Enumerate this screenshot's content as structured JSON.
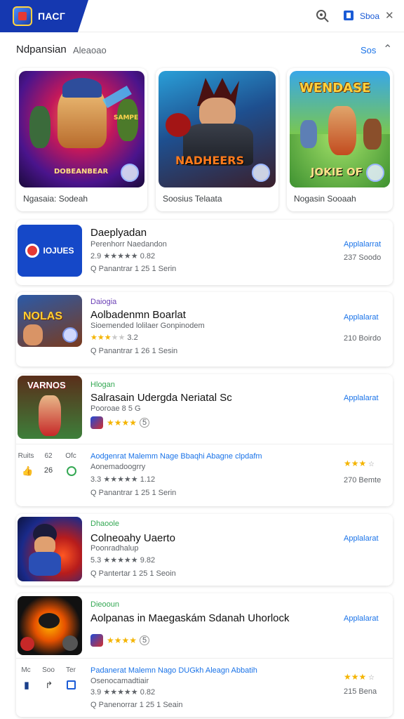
{
  "header": {
    "brand": "ПАСГ",
    "account_label": "Sboa",
    "icons": {
      "search": "search-icon",
      "account": "account-icon",
      "close": "close-icon"
    }
  },
  "section": {
    "title": "Ndpansian",
    "subtitle": "Aleaoao",
    "more": "Sos"
  },
  "featured": [
    {
      "label": "Ngasaia: Sodeah",
      "art_title": "DOBEANBEAR",
      "top_text": "SAMPE"
    },
    {
      "label": "Soosius Telaata",
      "art_title": "NADHEERS",
      "top_text": ""
    },
    {
      "label": "Nogasin Sooaah",
      "art_title": "WENDASE",
      "bottom_text": "JOKIE OF"
    }
  ],
  "list": [
    {
      "tag": "",
      "name": "Daeplyadan",
      "sub": "Perenhorr Naedandon",
      "rating_text": "2.9 ★★★★★ 0.82",
      "stars_on": 0,
      "stats": "Q Panantrar  1 25 1 Serin",
      "install": "Applalarrat",
      "size": "237 Soodo",
      "icon_text": "IOJUES"
    },
    {
      "tag": "Daiogia",
      "name": "Aolbadenmn Boarlat",
      "sub": "Sioemended lolilaer Gonpinodem",
      "rating_text": "3.2",
      "stars_on": 3,
      "stats": "Q Panantrar  1 26 1 Sesin",
      "install": "Applalarat",
      "size": "210 Boirdo",
      "icon_text": "NOLAS"
    },
    {
      "tag": "Hlogan",
      "name": "Salrasain Udergda Neriatal Sc",
      "sub": "Pooroae 8 5 G",
      "stars_count": "5",
      "install": "Applalarat",
      "icon_text": "VARNOS",
      "features": [
        {
          "label": "Ruits",
          "icon": "thumbs-up-icon"
        },
        {
          "label": "62",
          "icon": "number-icon"
        },
        {
          "label": "Ofc",
          "icon": "ring-icon"
        }
      ],
      "feature_values": [
        "",
        "26",
        ""
      ],
      "subhead": "Aodgenrat Malemm Nage Bbaqhi Abagne clpdafm",
      "subhead2": "Aonemadoogrry",
      "rating_text": "3.3 ★★★★★ 1.12",
      "stats": "Q Panantrar  1 25 1 Serin",
      "size": "270 Bemte"
    },
    {
      "tag": "Dhaoole",
      "name": "Colneoahy Uaerto",
      "sub": "Poonradhalup",
      "rating_text": "5.3 ★★★★★ 9.82",
      "stats": "Q Pantertar  1 25 1 Seoin",
      "install": "Applalarat"
    },
    {
      "tag": "Dieooun",
      "name": "Aolpanas in Maegaskám Sdanah Uhorlock",
      "stars_count": "5",
      "install": "Applalarat",
      "features": [
        {
          "label": "Mc",
          "icon": "chart-icon"
        },
        {
          "label": "Soo",
          "icon": "share-icon"
        },
        {
          "label": "Ter",
          "icon": "box-icon"
        }
      ],
      "subhead": "Padanerat Malemn Nago DUGkh Aleagn Abbatih",
      "subhead2": "Osenocamadtiair",
      "rating_text": "3.9 ★★★★★ 0.82",
      "stats": "Q Panenorrar  1 25 1 Seain",
      "size": "215 Bena"
    }
  ],
  "colors": {
    "brand": "#1538b0",
    "accent": "#1a73e8",
    "tag_green": "#34a853",
    "star": "#f4b400"
  }
}
